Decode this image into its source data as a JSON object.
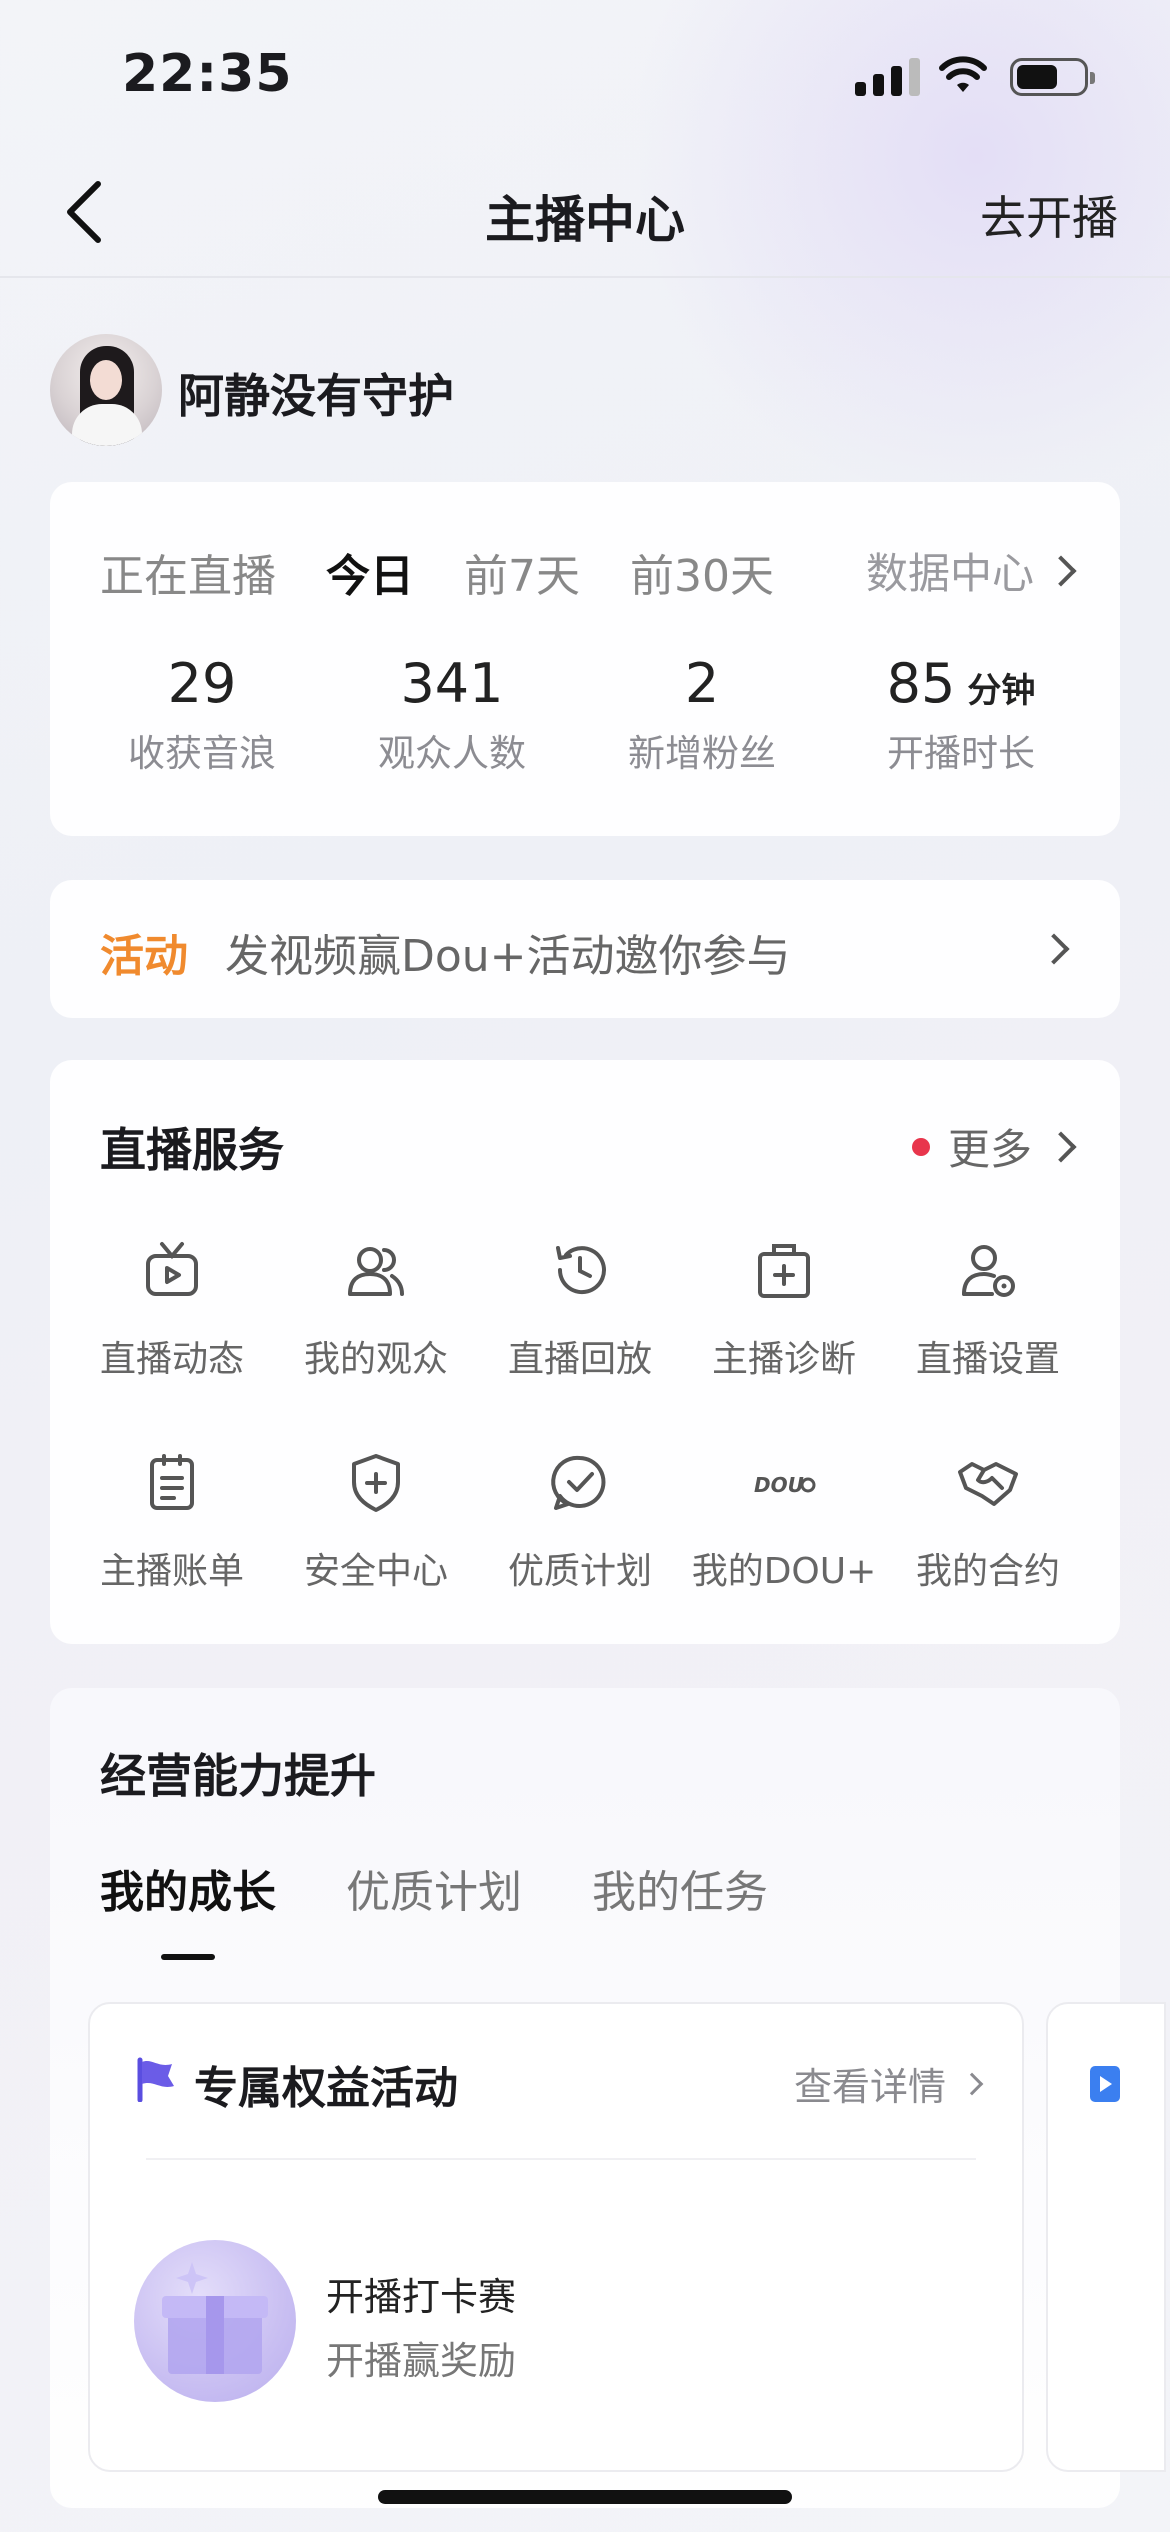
{
  "status_bar": {
    "time": "22:35"
  },
  "nav": {
    "title": "主播中心",
    "action": "去开播"
  },
  "profile": {
    "username": "阿静没有守护"
  },
  "stats": {
    "tabs": [
      "正在直播",
      "今日",
      "前7天",
      "前30天"
    ],
    "active_tab": "今日",
    "data_center": "数据中心",
    "items": [
      {
        "value": "29",
        "unit": "",
        "label": "收获音浪"
      },
      {
        "value": "341",
        "unit": "",
        "label": "观众人数"
      },
      {
        "value": "2",
        "unit": "",
        "label": "新增粉丝"
      },
      {
        "value": "85",
        "unit": "分钟",
        "label": "开播时长"
      }
    ]
  },
  "activity": {
    "tag": "活动",
    "text": "发视频赢Dou+活动邀你参与"
  },
  "services": {
    "title": "直播服务",
    "more": "更多",
    "items": [
      {
        "label": "直播动态",
        "icon": "tv-icon"
      },
      {
        "label": "我的观众",
        "icon": "users-icon"
      },
      {
        "label": "直播回放",
        "icon": "history-icon"
      },
      {
        "label": "主播诊断",
        "icon": "medical-kit-icon"
      },
      {
        "label": "直播设置",
        "icon": "user-settings-icon"
      },
      {
        "label": "主播账单",
        "icon": "clipboard-icon"
      },
      {
        "label": "安全中心",
        "icon": "shield-plus-icon"
      },
      {
        "label": "优质计划",
        "icon": "check-circle-icon"
      },
      {
        "label": "我的DOU+",
        "icon": "dou-logo-icon"
      },
      {
        "label": "我的合约",
        "icon": "handshake-icon"
      }
    ],
    "dou_logo_text": "DOU"
  },
  "growth": {
    "title": "经营能力提升",
    "tabs": [
      "我的成长",
      "优质计划",
      "我的任务"
    ],
    "active_tab": "我的成长",
    "card": {
      "title": "专属权益活动",
      "more": "查看详情",
      "task_title": "开播打卡赛",
      "task_sub": "开播赢奖励"
    }
  },
  "colors": {
    "accent_orange": "#f08a2e",
    "red_dot": "#e8354c",
    "flag_purple": "#6b5ce7"
  }
}
